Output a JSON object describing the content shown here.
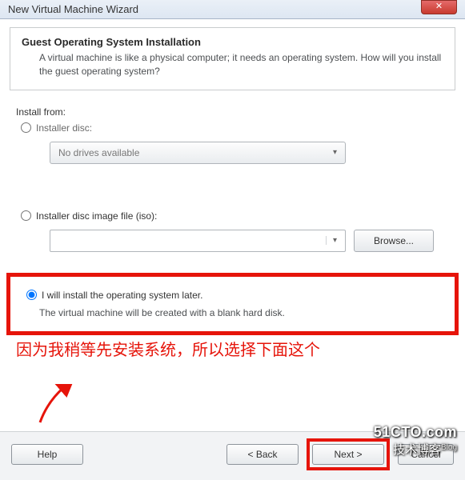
{
  "titlebar": {
    "text": "New Virtual Machine Wizard"
  },
  "header": {
    "title": "Guest Operating System Installation",
    "sub": "A virtual machine is like a physical computer; it needs an operating system. How will you install the guest operating system?"
  },
  "install": {
    "from_label": "Install from:",
    "opt_disc": "Installer disc:",
    "disc_dropdown": "No drives available",
    "opt_iso": "Installer disc image file (iso):",
    "browse": "Browse...",
    "opt_later": "I will install the operating system later.",
    "later_desc": "The virtual machine will be created with a blank hard disk."
  },
  "annotation": {
    "note": "因为我稍等先安装系统，所以选择下面这个"
  },
  "footer": {
    "help": "Help",
    "back": "< Back",
    "next": "Next >",
    "cancel": "Cancel"
  },
  "watermark": {
    "line1": "51CTO.com",
    "line2": "技术博客",
    "tag": "Blog"
  }
}
